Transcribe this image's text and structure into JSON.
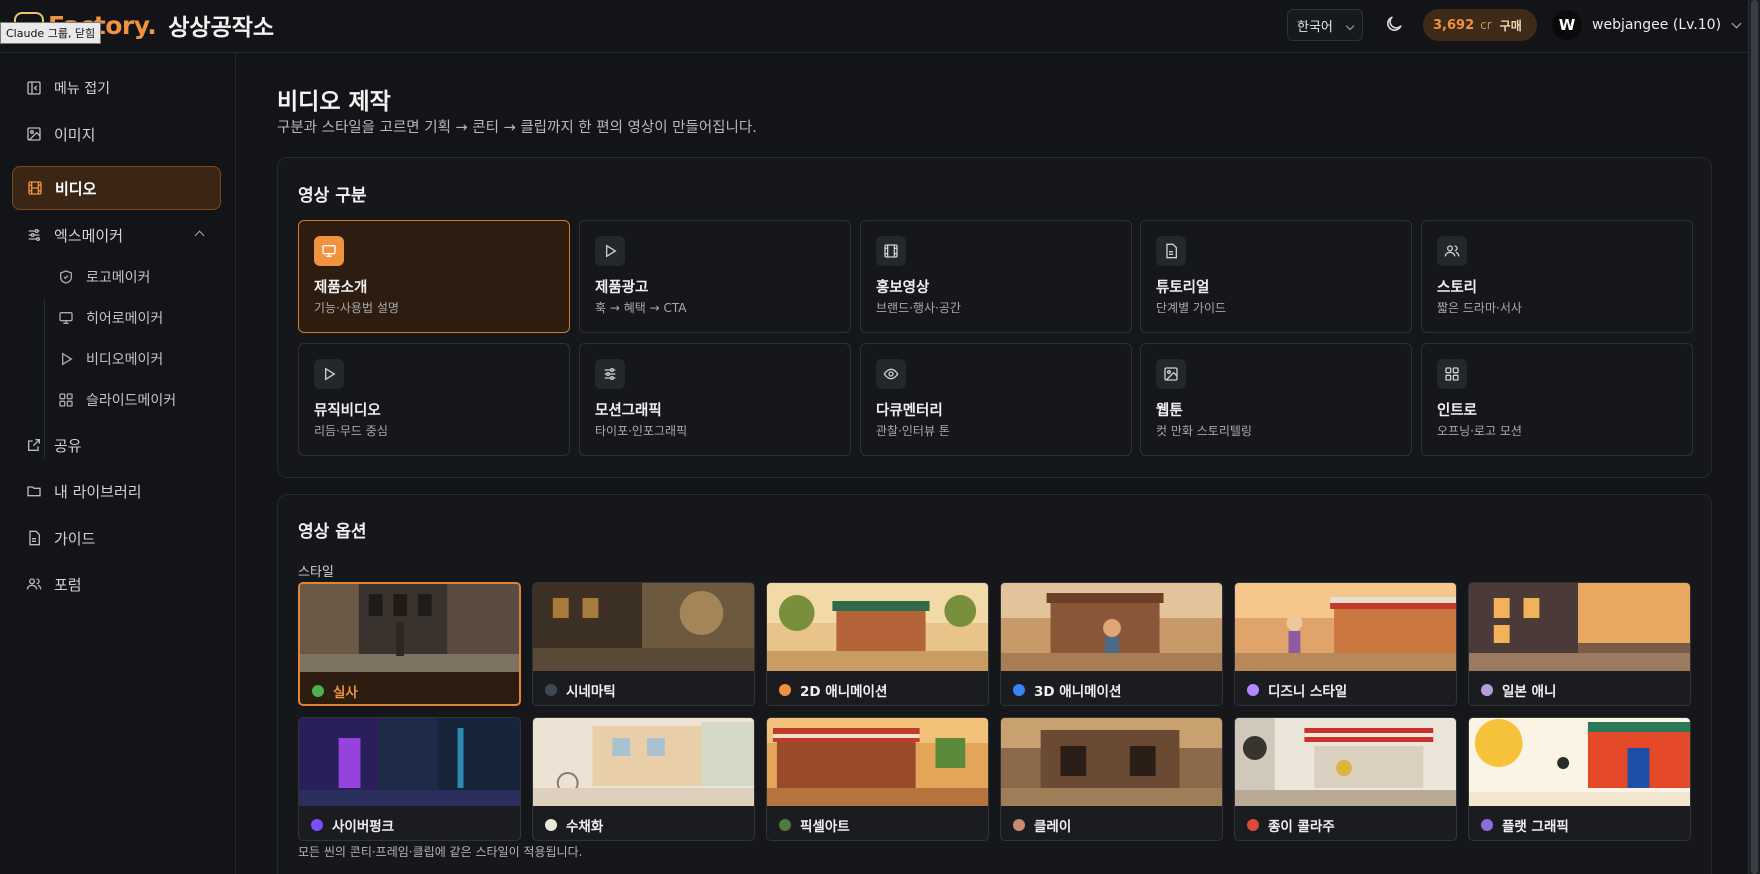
{
  "header": {
    "brand_word": "Factory.",
    "brand_name": "상상공작소",
    "tooltip": "Claude 그룹, 닫힘",
    "language": "한국어",
    "credits": "3,692",
    "credit_unit": "cr",
    "buy_label": "구매",
    "avatar_initial": "W",
    "username": "webjangee (Lv.10)",
    "accent_color": "#f0923f"
  },
  "sidebar": {
    "collapse_label": "메뉴 접기",
    "items": {
      "image": "이미지",
      "video": "비디오",
      "xmaker": "엑스메이커",
      "logo_maker": "로고메이커",
      "hero_maker": "히어로메이커",
      "video_maker": "비디오메이커",
      "slide_maker": "슬라이드메이커",
      "share": "공유",
      "library": "내 라이브러리",
      "guide": "가이드",
      "forum": "포럼"
    }
  },
  "page": {
    "title": "비디오 제작",
    "subtitle": "구분과 스타일을 고르면 기획 → 콘티 → 클립까지 한 편의 영상이 만들어집니다."
  },
  "categories": {
    "title": "영상 구분",
    "items": [
      {
        "name": "제품소개",
        "desc": "기능·사용법 설명",
        "icon": "monitor-icon",
        "selected": true
      },
      {
        "name": "제품광고",
        "desc": "훅 → 혜택 → CTA",
        "icon": "play-icon",
        "selected": false
      },
      {
        "name": "홍보영상",
        "desc": "브랜드·행사·공간",
        "icon": "film-icon",
        "selected": false
      },
      {
        "name": "튜토리얼",
        "desc": "단계별 가이드",
        "icon": "document-icon",
        "selected": false
      },
      {
        "name": "스토리",
        "desc": "짧은 드라마·서사",
        "icon": "users-icon",
        "selected": false
      },
      {
        "name": "뮤직비디오",
        "desc": "리듬·무드 중심",
        "icon": "play-icon",
        "selected": false
      },
      {
        "name": "모션그래픽",
        "desc": "타이포·인포그래픽",
        "icon": "sliders-icon",
        "selected": false
      },
      {
        "name": "다큐멘터리",
        "desc": "관찰·인터뷰 톤",
        "icon": "eye-icon",
        "selected": false
      },
      {
        "name": "웹툰",
        "desc": "컷 만화 스토리텔링",
        "icon": "image-icon",
        "selected": false
      },
      {
        "name": "인트로",
        "desc": "오프닝·로고 모션",
        "icon": "grid-icon",
        "selected": false
      }
    ]
  },
  "options": {
    "title": "영상 옵션",
    "style_label": "스타일",
    "note": "모든 씬의 콘티·프레임·클립에 같은 스타일이 적용됩니다.",
    "styles": [
      {
        "name": "실사",
        "dot": "#4caf50",
        "selected": true
      },
      {
        "name": "시네마틱",
        "dot": "#3d4a55",
        "selected": false
      },
      {
        "name": "2D 애니메이션",
        "dot": "#f0923f",
        "selected": false
      },
      {
        "name": "3D 애니메이션",
        "dot": "#3b82f6",
        "selected": false
      },
      {
        "name": "디즈니 스타일",
        "dot": "#b388ff",
        "selected": false
      },
      {
        "name": "일본 애니",
        "dot": "#b39ddb",
        "selected": false
      },
      {
        "name": "사이버펑크",
        "dot": "#7c4dff",
        "selected": false
      },
      {
        "name": "수채화",
        "dot": "#e6ebd9",
        "selected": false
      },
      {
        "name": "픽셀아트",
        "dot": "#4f7a3a",
        "selected": false
      },
      {
        "name": "클레이",
        "dot": "#c98a73",
        "selected": false
      },
      {
        "name": "종이 콜라주",
        "dot": "#d84a3a",
        "selected": false
      },
      {
        "name": "플랫 그래픽",
        "dot": "#8e6bd8",
        "selected": false
      }
    ]
  }
}
